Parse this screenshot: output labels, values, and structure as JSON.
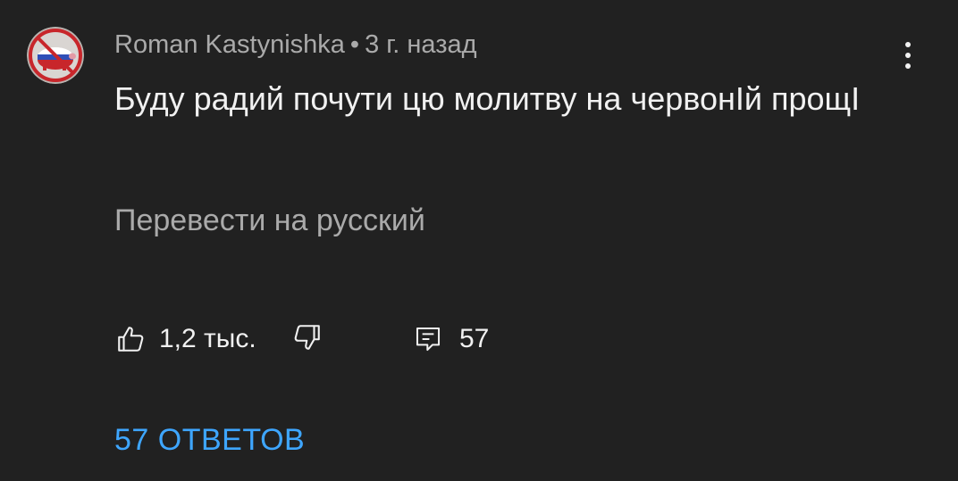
{
  "comment": {
    "author": "Roman Kastynishka",
    "separator": "•",
    "timestamp": "3 г. назад",
    "text": "Буду радий почути цю молитву на червонІй прощІ",
    "translate_label": "Перевести на русский",
    "like_count": "1,2 тыс.",
    "reply_count": "57",
    "replies_label": "57 ОТВЕТОВ"
  },
  "icons": {
    "avatar": "avatar-image",
    "menu": "more-vert-icon",
    "like": "thumb-up-icon",
    "dislike": "thumb-down-icon",
    "reply": "comment-icon"
  },
  "colors": {
    "background": "#212121",
    "primary_text": "#f1f1f1",
    "secondary_text": "#aaaaaa",
    "link": "#3ea6ff"
  }
}
